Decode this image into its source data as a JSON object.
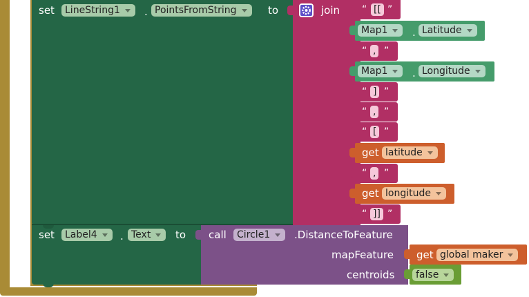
{
  "colors": {
    "event_block": "#a98b36",
    "setter_block": "#246646",
    "join_block": "#b12f64",
    "text_block": "#b12f64",
    "map_getter_block": "#459c6b",
    "variable_block": "#cd5e2c",
    "call_block": "#7c5188",
    "logic_block": "#6a9d35"
  },
  "set_points": {
    "keyword": "set",
    "component": "LineString1",
    "dot": ".",
    "property": "PointsFromString",
    "to": "to"
  },
  "join": {
    "label": "join",
    "gear_icon": "gear-icon",
    "items": [
      {
        "kind": "text",
        "open_quote": "“",
        "value": "[[",
        "close_quote": "”"
      },
      {
        "kind": "getter",
        "component": "Map1",
        "dot": ".",
        "property": "Latitude"
      },
      {
        "kind": "text",
        "open_quote": "“",
        "value": ",",
        "close_quote": "”"
      },
      {
        "kind": "getter",
        "component": "Map1",
        "dot": ".",
        "property": "Longitude"
      },
      {
        "kind": "text",
        "open_quote": "“",
        "value": "]",
        "close_quote": "”"
      },
      {
        "kind": "text",
        "open_quote": "“",
        "value": ",",
        "close_quote": "”"
      },
      {
        "kind": "text",
        "open_quote": "“",
        "value": "[",
        "close_quote": "”"
      },
      {
        "kind": "var",
        "keyword": "get",
        "name": "latitude"
      },
      {
        "kind": "text",
        "open_quote": "“",
        "value": ",",
        "close_quote": "”"
      },
      {
        "kind": "var",
        "keyword": "get",
        "name": "longitude"
      },
      {
        "kind": "text",
        "open_quote": "“",
        "value": "]]",
        "close_quote": "”"
      }
    ]
  },
  "set_label": {
    "keyword": "set",
    "component": "Label4",
    "dot": ".",
    "property": "Text",
    "to": "to"
  },
  "call": {
    "keyword": "call",
    "component": "Circle1",
    "method": ".DistanceToFeature",
    "arg1_label": "mapFeature",
    "arg1_get": "get",
    "arg1_var": "global maker",
    "arg2_label": "centroids",
    "arg2_value": "false"
  }
}
